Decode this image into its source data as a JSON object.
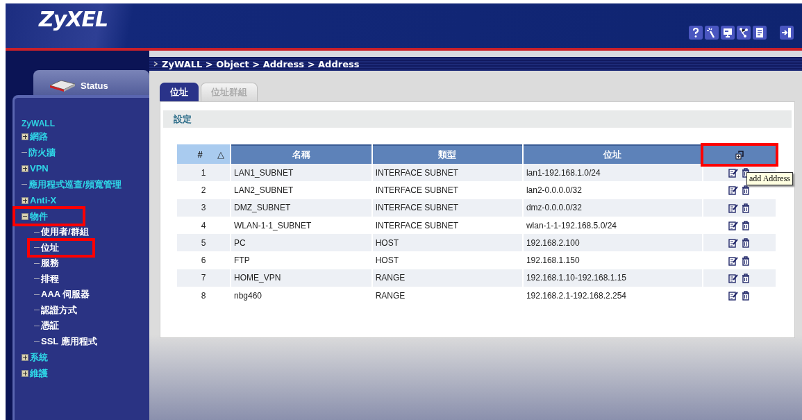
{
  "header": {
    "logo": "ZyXEL"
  },
  "sidebar": {
    "status_tab": "Status",
    "root": "ZyWALL",
    "items": [
      {
        "label": "網路",
        "expanded": false,
        "highlighted": false
      },
      {
        "label": "防火牆",
        "highlighted": false
      },
      {
        "label": "VPN",
        "expanded": false,
        "highlighted": false
      },
      {
        "label": "應用程式巡查/頻寬管理",
        "highlighted": false
      },
      {
        "label": "Anti-X",
        "expanded": false,
        "highlighted": false
      },
      {
        "label": "物件",
        "expanded": true,
        "highlighted": true,
        "children": [
          {
            "label": "使用者/群組",
            "highlighted": false
          },
          {
            "label": "位址",
            "highlighted": true
          },
          {
            "label": "服務",
            "highlighted": false
          },
          {
            "label": "排程",
            "highlighted": false
          },
          {
            "label": "AAA 伺服器",
            "highlighted": false
          },
          {
            "label": "認證方式",
            "highlighted": false
          },
          {
            "label": "憑証",
            "highlighted": false
          },
          {
            "label": "SSL 應用程式",
            "highlighted": false
          }
        ]
      },
      {
        "label": "系統",
        "expanded": false,
        "highlighted": false
      },
      {
        "label": "維護",
        "expanded": false,
        "highlighted": false
      }
    ]
  },
  "breadcrumb": "ZyWALL > Object > Address > Address",
  "tabs": [
    {
      "label": "位址",
      "selected": true
    },
    {
      "label": "位址群組",
      "selected": false
    }
  ],
  "section_title": "設定",
  "table": {
    "columns": [
      "#",
      "名稱",
      "類型",
      "位址"
    ],
    "sort_mark": "△",
    "add_highlighted": true,
    "tooltip": "add Address",
    "rows": [
      [
        "1",
        "LAN1_SUBNET",
        "INTERFACE SUBNET",
        "lan1-192.168.1.0/24"
      ],
      [
        "2",
        "LAN2_SUBNET",
        "INTERFACE SUBNET",
        "lan2-0.0.0.0/32"
      ],
      [
        "3",
        "DMZ_SUBNET",
        "INTERFACE SUBNET",
        "dmz-0.0.0.0/32"
      ],
      [
        "4",
        "WLAN-1-1_SUBNET",
        "INTERFACE SUBNET",
        "wlan-1-1-192.168.5.0/24"
      ],
      [
        "5",
        "PC",
        "HOST",
        "192.168.2.100"
      ],
      [
        "6",
        "FTP",
        "HOST",
        "192.168.1.150"
      ],
      [
        "7",
        "HOME_VPN",
        "RANGE",
        "192.168.1.10-192.168.1.15"
      ],
      [
        "8",
        "nbg460",
        "RANGE",
        "192.168.2.1-192.168.2.254"
      ]
    ]
  }
}
